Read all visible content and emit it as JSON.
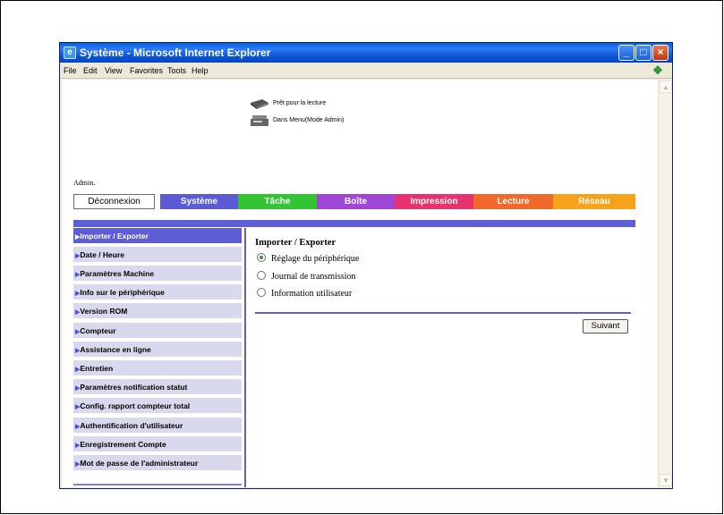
{
  "window": {
    "title": "Système - Microsoft Internet Explorer",
    "menu": [
      "File",
      "Edit",
      "View",
      "Favorites",
      "Tools",
      "Help"
    ]
  },
  "status": [
    {
      "icon": "printer-icon",
      "text": "Prêt pour la lecture"
    },
    {
      "icon": "copier-icon",
      "text": "Dans Menu(Mode Admin)"
    }
  ],
  "admin_label": "Admin.",
  "nav": {
    "logout": "Déconnexion",
    "tabs": [
      {
        "label": "Système",
        "color": "#5b5bd6"
      },
      {
        "label": "Tâche",
        "color": "#32c432"
      },
      {
        "label": "Boîte",
        "color": "#a046d6"
      },
      {
        "label": "Impression",
        "color": "#e8326e"
      },
      {
        "label": "Lecture",
        "color": "#f0682a"
      },
      {
        "label": "Réseau",
        "color": "#f6a21a"
      }
    ]
  },
  "sidebar": {
    "items": [
      "Importer / Exporter",
      "Date / Heure",
      "Paramètres Machine",
      "Info sur le périphérique",
      "Version ROM",
      "Compteur",
      "Assistance en ligne",
      "Entretien",
      "Paramètres notification statut",
      "Config. rapport compteur total",
      "Authentification d'utilisateur",
      "Enregistrement Compte",
      "Mot de passe de l'administrateur"
    ],
    "active_index": 0
  },
  "main": {
    "title": "Importer / Exporter",
    "options": [
      {
        "label": "Réglage du périphérique",
        "checked": true
      },
      {
        "label": "Journal de transmission",
        "checked": false
      },
      {
        "label": "Information utilisateur",
        "checked": false
      }
    ],
    "next_button": "Suivant"
  },
  "colors": {
    "accent": "#5b5bd6",
    "sidebar_bg": "#d9d9ee"
  }
}
